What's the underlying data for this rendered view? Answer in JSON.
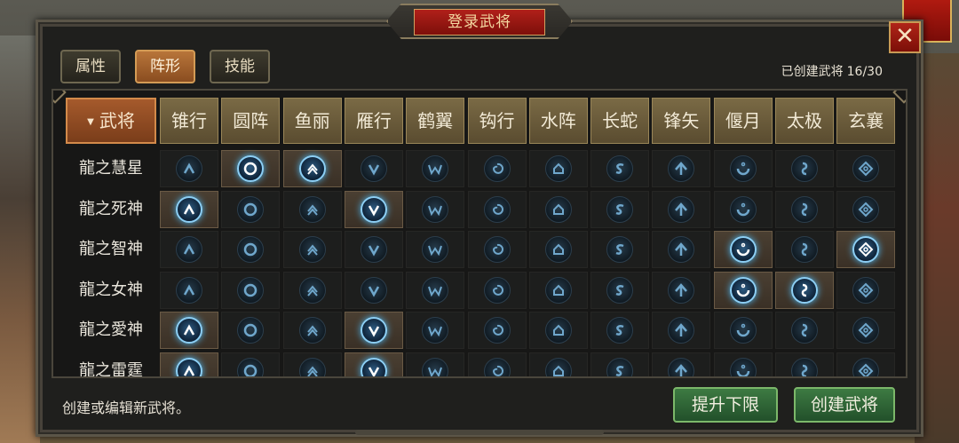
{
  "dialog": {
    "title": "登录武将",
    "close_label": "✕",
    "created_label": "已创建武将",
    "created_count": "16/30"
  },
  "tabs": [
    {
      "label": "属性",
      "active": false
    },
    {
      "label": "阵形",
      "active": true
    },
    {
      "label": "技能",
      "active": false
    }
  ],
  "table": {
    "general_header": "武将",
    "formations": [
      "锥行",
      "圆阵",
      "鱼丽",
      "雁行",
      "鹤翼",
      "钩行",
      "水阵",
      "长蛇",
      "锋矢",
      "偃月",
      "太极",
      "玄襄"
    ],
    "formation_icons": [
      "chevron-up-icon",
      "ring-icon",
      "double-chevron-icon",
      "v-icon",
      "w-icon",
      "swirl-icon",
      "arch-icon",
      "s-icon",
      "arrow-up-icon",
      "crescent-icon",
      "taiji-icon",
      "diamond-icon"
    ],
    "rows": [
      {
        "name": "龍之慧星",
        "selected": [
          1,
          2
        ]
      },
      {
        "name": "龍之死神",
        "selected": [
          0,
          3
        ]
      },
      {
        "name": "龍之智神",
        "selected": [
          9,
          11
        ]
      },
      {
        "name": "龍之女神",
        "selected": [
          9,
          10
        ]
      },
      {
        "name": "龍之愛神",
        "selected": [
          0,
          3
        ]
      },
      {
        "name": "龍之雷霆",
        "selected": [
          0,
          3
        ]
      }
    ]
  },
  "footer": {
    "hint": "创建或编辑新武将。",
    "raise_limit_label": "提升下限",
    "create_label": "创建武将"
  },
  "colors": {
    "accent_active": "#b8753a",
    "icon_glow": "#4db6f0",
    "button_green": "#3d7a42"
  }
}
